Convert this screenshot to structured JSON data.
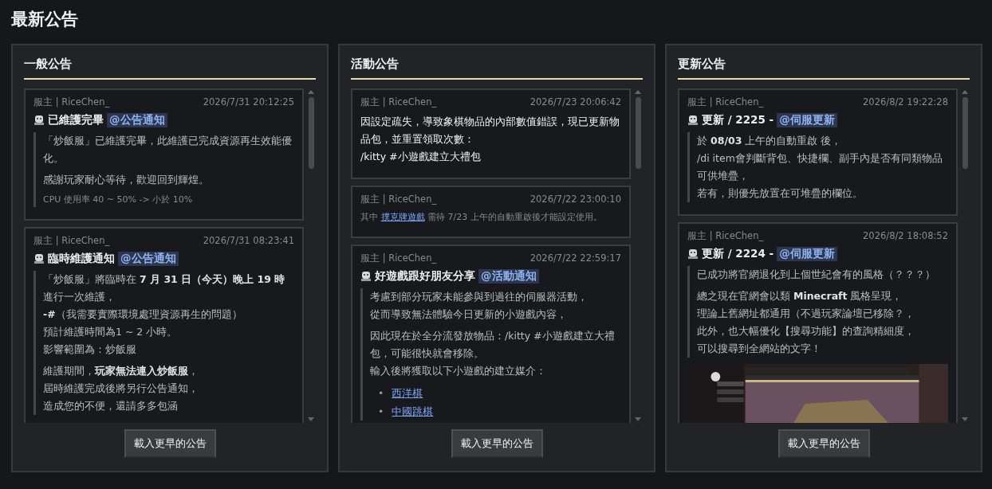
{
  "page_title": "最新公告",
  "columns": [
    {
      "title": "一般公告",
      "button": "載入更早的公告",
      "posts": [
        {
          "author": "服主 | RiceChen_",
          "time": "2026/7/31 20:12:25",
          "heading": {
            "title": "已維護完畢",
            "tag": "@公告通知"
          },
          "quoted": true,
          "paragraphs": [
            {
              "kind": "text",
              "lines": [
                "「炒飯服」已維護完畢，此維護已完成資源再生效能優化。"
              ]
            },
            {
              "kind": "text",
              "lines": [
                "感謝玩家耐心等待，歡迎回到輝煌。"
              ]
            },
            {
              "kind": "small",
              "lines": [
                "CPU 使用率 40 ~ 50% -> 小於 10%"
              ]
            }
          ]
        },
        {
          "author": "服主 | RiceChen_",
          "time": "2026/7/31 08:23:41",
          "heading": {
            "title": "臨時維護通知",
            "tag": "@公告通知"
          },
          "quoted": true,
          "paragraphs": [
            {
              "kind": "text",
              "lines": [
                "「炒飯服」將臨時在 **7 月 31 日（今天）晚上 19 時**進行一次維護，",
                "**-#**（我需要實際環境處理資源再生的問題）",
                "預計維護時間為1 ~ 2 小時。",
                "影響範圍為：炒飯服"
              ]
            },
            {
              "kind": "text",
              "lines": [
                "維護期間，**玩家無法連入炒飯服**，",
                "屆時維護完成後將另行公告通知，",
                "造成您的不便，還請多多包涵"
              ]
            }
          ]
        }
      ]
    },
    {
      "title": "活動公告",
      "button": "載入更早的公告",
      "posts": [
        {
          "author": "服主 | RiceChen_",
          "time": "2026/7/23 20:06:42",
          "quoted": false,
          "paragraphs": [
            {
              "kind": "bright",
              "lines": [
                "因設定疏失，導致象棋物品的內部數值錯誤，現已更新物品包，並重置領取次數：",
                "/kitty #小遊戲建立大禮包"
              ]
            }
          ]
        },
        {
          "author": "服主 | RiceChen_",
          "time": "2026/7/22 23:00:10",
          "quoted": false,
          "paragraphs": [
            {
              "kind": "small",
              "lines": [
                {
                  "before": "其中 ",
                  "link": "撲克牌遊戲",
                  "after": " 需待 7/23 上午的自動重啟後才能設定使用。"
                }
              ]
            }
          ]
        },
        {
          "author": "服主 | RiceChen_",
          "time": "2026/7/22 22:59:17",
          "heading": {
            "title": "好遊戲跟好朋友分享",
            "tag": "@活動通知"
          },
          "quoted": true,
          "paragraphs": [
            {
              "kind": "text",
              "lines": [
                "考慮到部分玩家未能參與到過往的伺服器活動，",
                "從而導致無法體驗今日更新的小遊戲內容，"
              ]
            },
            {
              "kind": "text",
              "lines": [
                "因此現在於全分流發放物品：/kitty #小遊戲建立大禮包，可能很快就會移除。",
                "輸入後將獲取以下小遊戲的建立媒介："
              ]
            }
          ],
          "links": [
            {
              "marker": "•",
              "text": "西洋棋"
            },
            {
              "marker": "•",
              "text": "中國跳棋"
            }
          ]
        }
      ]
    },
    {
      "title": "更新公告",
      "button": "載入更早的公告",
      "posts": [
        {
          "author": "服主 | RiceChen_",
          "time": "2026/8/2 19:22:28",
          "heading": {
            "title": "更新 / 2225 -",
            "tag": "@伺服更新"
          },
          "quoted": true,
          "paragraphs": [
            {
              "kind": "text",
              "lines": [
                "於 **08/03** 上午的自動重啟 後，",
                "/di item會判斷背包、快捷欄、副手內是否有同類物品可供堆疊，",
                "若有，則優先放置在可堆疊的欄位。"
              ]
            }
          ]
        },
        {
          "author": "服主 | RiceChen_",
          "time": "2026/8/2 18:08:52",
          "heading": {
            "title": "更新 / 2224 -",
            "tag": "@伺服更新"
          },
          "quoted": true,
          "paragraphs": [
            {
              "kind": "text",
              "lines": [
                "已成功將官網退化到上個世紀會有的風格（？？？）"
              ]
            },
            {
              "kind": "text",
              "lines": [
                "總之現在官網會以類 **Minecraft** 風格呈現，",
                "理論上舊網址都通用（不過玩家論壇已移除？，",
                "此外，也大幅優化【搜尋功能】的查詢精細度，",
                "可以搜尋到全網站的文字！"
              ]
            }
          ],
          "image": {
            "kind": "picture"
          }
        }
      ]
    }
  ]
}
